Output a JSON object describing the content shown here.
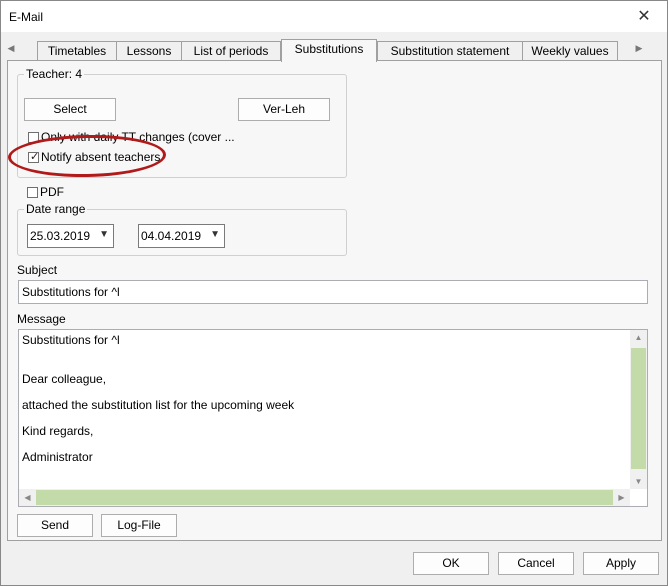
{
  "window": {
    "title": "E-Mail"
  },
  "tabs": [
    {
      "label": "Timetables"
    },
    {
      "label": "Lessons"
    },
    {
      "label": "List of periods"
    },
    {
      "label": "Substitutions"
    },
    {
      "label": "Substitution statement"
    },
    {
      "label": "Weekly values"
    }
  ],
  "active_tab": "Substitutions",
  "teacher_group": {
    "legend": "Teacher: 4",
    "select_label": "Select",
    "verleh_label": "Ver-Leh",
    "only_daily_label": "Only with daily TT changes (cover ...",
    "only_daily_checked": false,
    "notify_label": "Notify absent teachers",
    "notify_checked": true
  },
  "pdf": {
    "label": "PDF",
    "checked": false
  },
  "date_range": {
    "legend": "Date range",
    "from": "25.03.2019",
    "to": "04.04.2019"
  },
  "subject": {
    "label": "Subject",
    "value": "Substitutions for ^l"
  },
  "message": {
    "label": "Message",
    "lines": [
      "Substitutions for ^l",
      "",
      "Dear colleague,",
      "attached the substitution list for the upcoming week",
      "Kind regards,",
      "Administrator"
    ]
  },
  "actions": {
    "send_label": "Send",
    "logfile_label": "Log-File"
  },
  "footer": {
    "ok_label": "OK",
    "cancel_label": "Cancel",
    "apply_label": "Apply"
  },
  "colors": {
    "annotation": "#b01a1a",
    "scroll_thumb": "#c3dba8"
  }
}
